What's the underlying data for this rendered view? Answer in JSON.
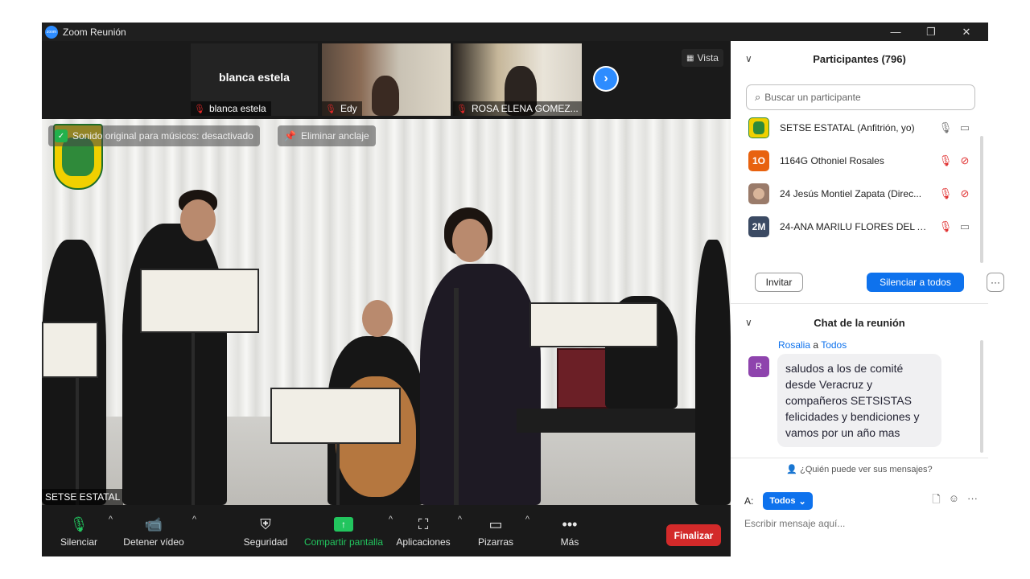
{
  "window": {
    "title": "Zoom Reunión",
    "logo_text": "zoom"
  },
  "window_controls": {
    "minimize": "—",
    "restore": "❐",
    "close": "✕"
  },
  "top_strip": {
    "tiles": [
      {
        "name": "blanca estela",
        "big_name": "blanca estela"
      },
      {
        "name": "Edy"
      },
      {
        "name": "ROSA ELENA GOMEZ..."
      }
    ],
    "view_label": "Vista"
  },
  "video": {
    "sound_notice": "Sonido original para músicos: desactivado",
    "unpin_label": "Eliminar anclaje",
    "self_name": "SETSE ESTATAL"
  },
  "toolbar": {
    "mute": "Silenciar",
    "stop_video": "Detener vídeo",
    "security": "Seguridad",
    "share": "Compartir pantalla",
    "apps": "Aplicaciones",
    "whiteboards": "Pizarras",
    "more": "Más",
    "end": "Finalizar"
  },
  "participants": {
    "title": "Participantes (796)",
    "search_placeholder": "Buscar un participante",
    "list": [
      {
        "name": "SETSE ESTATAL (Anfitrión, yo)",
        "avatar": "",
        "color": "#f0d000"
      },
      {
        "name": "1164G Othoniel Rosales",
        "avatar": "1O",
        "color": "#e8620f"
      },
      {
        "name": "24 Jesús Montiel Zapata (Direc...",
        "avatar": "",
        "color": "#9a7b6a"
      },
      {
        "name": "24-ANA MARILU FLORES DEL A...",
        "avatar": "2M",
        "color": "#3b4a63"
      }
    ],
    "invite": "Invitar",
    "mute_all": "Silenciar a todos",
    "more": "···"
  },
  "chat": {
    "title": "Chat de la reunión",
    "sender": "Rosalia",
    "to_word": "a",
    "recipient": "Todos",
    "avatar": "R",
    "message": "saludos a los de comité desde Veracruz y compañeros SETSISTAS felicidades  y bendiciones y vamos por un año mas",
    "who_can_see": "¿Quién puede ver sus mensajes?",
    "to_label": "A:",
    "to_select": "Todos",
    "input_placeholder": "Escribir mensaje aquí..."
  },
  "colors": {
    "accent": "#0e72ed",
    "end": "#d32a2a",
    "share": "#22c55e",
    "muted": "#e03030"
  }
}
